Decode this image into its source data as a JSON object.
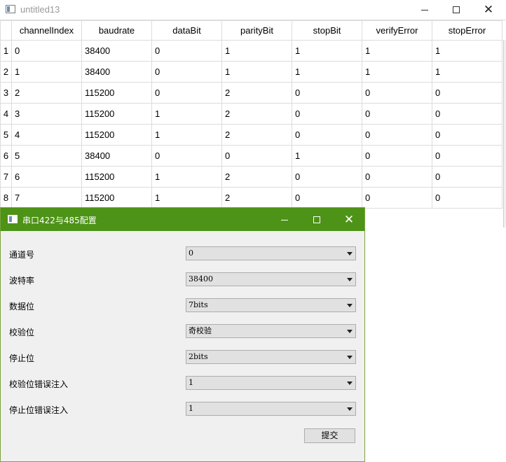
{
  "main_window": {
    "title": "untitled13",
    "table": {
      "headers": [
        "channelIndex",
        "baudrate",
        "dataBit",
        "parityBit",
        "stopBit",
        "verifyError",
        "stopError"
      ],
      "rows": [
        {
          "num": "1",
          "cells": [
            "0",
            "38400",
            "0",
            "1",
            "1",
            "1",
            "1"
          ]
        },
        {
          "num": "2",
          "cells": [
            "1",
            "38400",
            "0",
            "1",
            "1",
            "1",
            "1"
          ]
        },
        {
          "num": "3",
          "cells": [
            "2",
            "115200",
            "0",
            "2",
            "0",
            "0",
            "0"
          ]
        },
        {
          "num": "4",
          "cells": [
            "3",
            "115200",
            "1",
            "2",
            "0",
            "0",
            "0"
          ]
        },
        {
          "num": "5",
          "cells": [
            "4",
            "115200",
            "1",
            "2",
            "0",
            "0",
            "0"
          ]
        },
        {
          "num": "6",
          "cells": [
            "5",
            "38400",
            "0",
            "0",
            "1",
            "0",
            "0"
          ]
        },
        {
          "num": "7",
          "cells": [
            "6",
            "115200",
            "1",
            "2",
            "0",
            "0",
            "0"
          ]
        },
        {
          "num": "8",
          "cells": [
            "7",
            "115200",
            "1",
            "2",
            "0",
            "0",
            "0"
          ]
        }
      ]
    }
  },
  "dialog": {
    "title": "串口422与485配置",
    "accent_color": "#4d9317",
    "fields": [
      {
        "label": "通道号",
        "value": "0"
      },
      {
        "label": "波特率",
        "value": "38400"
      },
      {
        "label": "数据位",
        "value": "7bits"
      },
      {
        "label": "校验位",
        "value": "奇校验"
      },
      {
        "label": "停止位",
        "value": "2bits"
      },
      {
        "label": "校验位错误注入",
        "value": "1"
      },
      {
        "label": "停止位错误注入",
        "value": "1"
      }
    ],
    "submit_label": "提交"
  }
}
